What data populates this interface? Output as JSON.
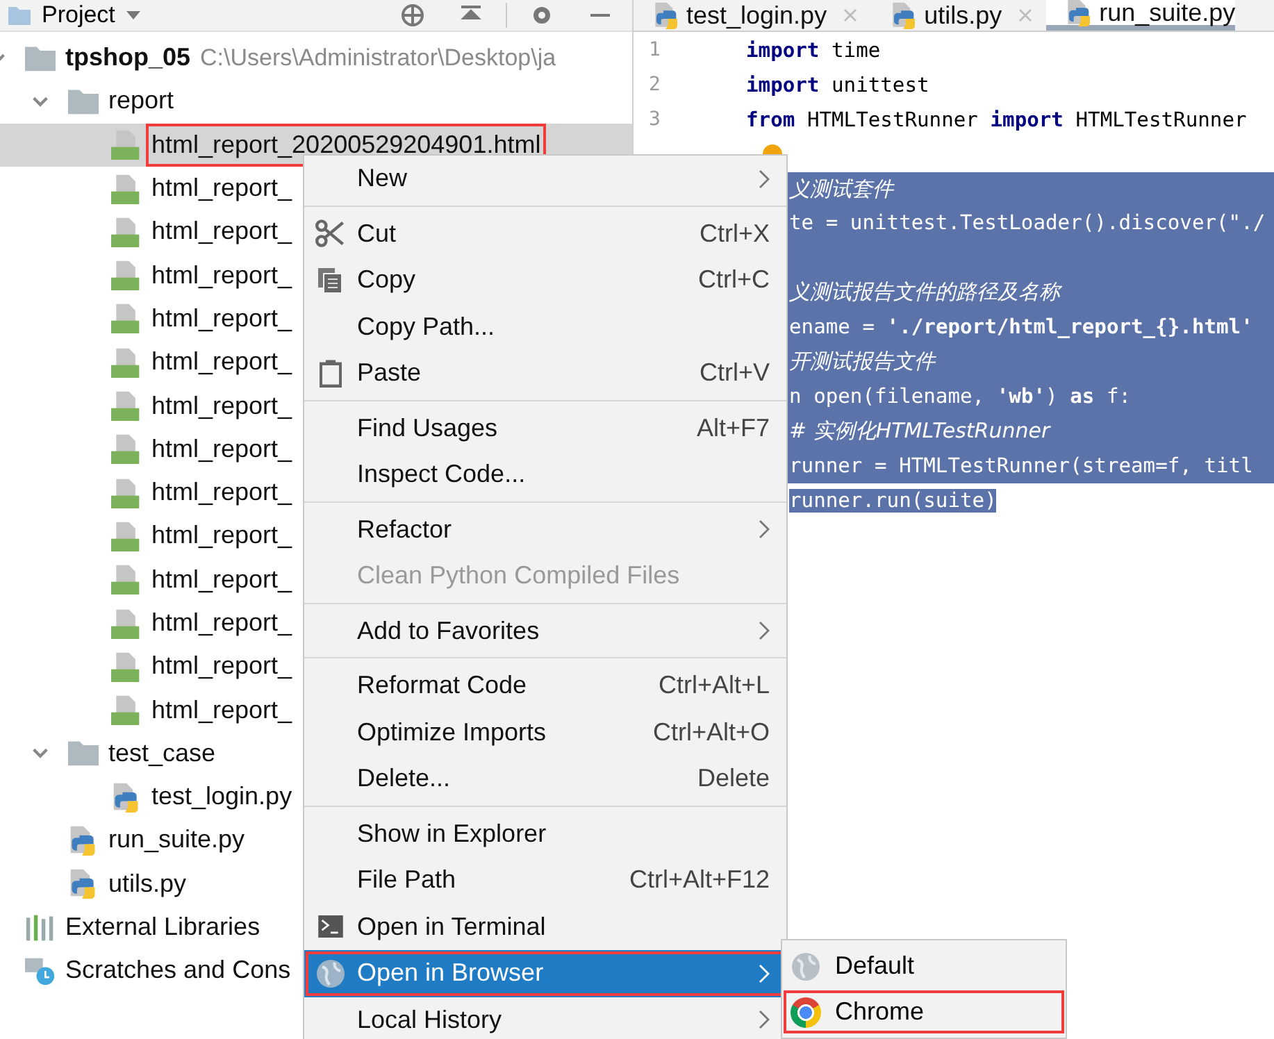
{
  "project_panel": {
    "title": "Project"
  },
  "project_tree": [
    {
      "name": "tpshop_05",
      "kind": "module",
      "path": "C:\\Users\\Administrator\\Desktop\\ja",
      "expanded": true,
      "children": [
        {
          "name": "report",
          "kind": "folder",
          "expanded": true,
          "children": [
            {
              "name": "html_report_20200529204901.html",
              "kind": "html",
              "selected": true,
              "annotated": true
            },
            {
              "name": "html_report_",
              "kind": "html",
              "selected": false,
              "annotated": false
            },
            {
              "name": "html_report_",
              "kind": "html",
              "selected": false,
              "annotated": false
            },
            {
              "name": "html_report_",
              "kind": "html",
              "selected": false,
              "annotated": false
            },
            {
              "name": "html_report_",
              "kind": "html",
              "selected": false,
              "annotated": false
            },
            {
              "name": "html_report_",
              "kind": "html",
              "selected": false,
              "annotated": false
            },
            {
              "name": "html_report_",
              "kind": "html",
              "selected": false,
              "annotated": false
            },
            {
              "name": "html_report_",
              "kind": "html",
              "selected": false,
              "annotated": false
            },
            {
              "name": "html_report_",
              "kind": "html",
              "selected": false,
              "annotated": false
            },
            {
              "name": "html_report_",
              "kind": "html",
              "selected": false,
              "annotated": false
            },
            {
              "name": "html_report_",
              "kind": "html",
              "selected": false,
              "annotated": false
            },
            {
              "name": "html_report_",
              "kind": "html",
              "selected": false,
              "annotated": false
            },
            {
              "name": "html_report_",
              "kind": "html",
              "selected": false,
              "annotated": false
            },
            {
              "name": "html_report_",
              "kind": "html",
              "selected": false,
              "annotated": false
            }
          ]
        },
        {
          "name": "test_case",
          "kind": "folder",
          "expanded": true,
          "children": [
            {
              "name": "test_login.py",
              "kind": "python",
              "selected": false,
              "annotated": false
            }
          ]
        },
        {
          "name": "run_suite.py",
          "kind": "python",
          "selected": false,
          "annotated": false
        },
        {
          "name": "utils.py",
          "kind": "python",
          "selected": false,
          "annotated": false
        }
      ]
    },
    {
      "name": "External Libraries",
      "kind": "library"
    },
    {
      "name": "Scratches and Cons",
      "kind": "scratches"
    }
  ],
  "editor_tabs": [
    {
      "label": "test_login.py",
      "selected": false
    },
    {
      "label": "utils.py",
      "selected": false
    },
    {
      "label": "run_suite.py",
      "selected": true
    }
  ],
  "code_lines": [
    {
      "number": "1",
      "selected": false,
      "segments": [
        {
          "kind": "keyword",
          "text": "import"
        },
        {
          "kind": "plain",
          "text": " time"
        }
      ]
    },
    {
      "number": "2",
      "selected": false,
      "segments": [
        {
          "kind": "keyword",
          "text": "import"
        },
        {
          "kind": "plain",
          "text": " unittest"
        }
      ]
    },
    {
      "number": "3",
      "selected": false,
      "segments": [
        {
          "kind": "keyword",
          "text": "from"
        },
        {
          "kind": "plain",
          "text": " HTMLTestRunner "
        },
        {
          "kind": "keyword",
          "text": "import"
        },
        {
          "kind": "plain",
          "text": " HTMLTestRunner"
        }
      ]
    },
    {
      "selected": false,
      "bulb": true
    },
    {
      "selected": true,
      "segments": [
        {
          "kind": "comment",
          "text": "义测试套件"
        }
      ]
    },
    {
      "selected": true,
      "segments": [
        {
          "kind": "plain",
          "text": "te = unittest.TestLoader().discover(\"./"
        }
      ]
    },
    {
      "selected": true
    },
    {
      "selected": true,
      "segments": [
        {
          "kind": "comment",
          "text": "义测试报告文件的路径及名称"
        }
      ]
    },
    {
      "selected": true,
      "segments": [
        {
          "kind": "plain",
          "text": "ename = "
        },
        {
          "kind": "string",
          "text": "'./report/html_report_{}.html'"
        }
      ]
    },
    {
      "selected": true,
      "segments": [
        {
          "kind": "comment",
          "text": "开测试报告文件"
        }
      ]
    },
    {
      "selected": true,
      "segments": [
        {
          "kind": "plain",
          "text": "n open(filename, "
        },
        {
          "kind": "string",
          "text": "'wb'"
        },
        {
          "kind": "plain",
          "text": ") "
        },
        {
          "kind": "keyword",
          "text": "as"
        },
        {
          "kind": "plain",
          "text": " f:"
        }
      ]
    },
    {
      "selected": true,
      "segments": [
        {
          "kind": "comment",
          "text": " # 实例化HTMLTestRunner"
        }
      ]
    },
    {
      "selected": true,
      "segments": [
        {
          "kind": "plain",
          "text": " runner = HTMLTestRunner(stream=f, titl"
        }
      ]
    },
    {
      "selected": true,
      "segments": [
        {
          "kind": "plain",
          "text": " runner.run(suite)"
        }
      ]
    }
  ],
  "context_menu": [
    {
      "kind": "plain",
      "label": "New",
      "submenu": true
    },
    {
      "kind": "separator"
    },
    {
      "kind": "cut",
      "label": "Cut",
      "shortcut": "Ctrl+X"
    },
    {
      "kind": "copy",
      "label": "Copy",
      "shortcut": "Ctrl+C"
    },
    {
      "kind": "plain",
      "label": "Copy Path..."
    },
    {
      "kind": "paste",
      "label": "Paste",
      "shortcut": "Ctrl+V"
    },
    {
      "kind": "separator"
    },
    {
      "kind": "plain",
      "label": "Find Usages",
      "shortcut": "Alt+F7"
    },
    {
      "kind": "plain",
      "label": "Inspect Code..."
    },
    {
      "kind": "separator"
    },
    {
      "kind": "plain",
      "label": "Refactor",
      "submenu": true
    },
    {
      "kind": "plain",
      "label": "Clean Python Compiled Files",
      "disabled": true
    },
    {
      "kind": "separator"
    },
    {
      "kind": "plain",
      "label": "Add to Favorites",
      "submenu": true
    },
    {
      "kind": "separator"
    },
    {
      "kind": "plain",
      "label": "Reformat Code",
      "shortcut": "Ctrl+Alt+L"
    },
    {
      "kind": "plain",
      "label": "Optimize Imports",
      "shortcut": "Ctrl+Alt+O"
    },
    {
      "kind": "plain",
      "label": "Delete...",
      "shortcut": "Delete"
    },
    {
      "kind": "separator"
    },
    {
      "kind": "plain",
      "label": "Show in Explorer"
    },
    {
      "kind": "plain",
      "label": "File Path",
      "shortcut": "Ctrl+Alt+F12"
    },
    {
      "kind": "terminal",
      "label": "Open in Terminal"
    },
    {
      "kind": "browser",
      "label": "Open in Browser",
      "submenu": true,
      "selected": true,
      "annotated": true
    },
    {
      "kind": "plain",
      "label": "Local History",
      "submenu": true
    }
  ],
  "browser_submenu": [
    {
      "kind": "globe",
      "label": "Default",
      "annotated": false
    },
    {
      "kind": "chrome",
      "label": "Chrome",
      "annotated": true
    }
  ]
}
